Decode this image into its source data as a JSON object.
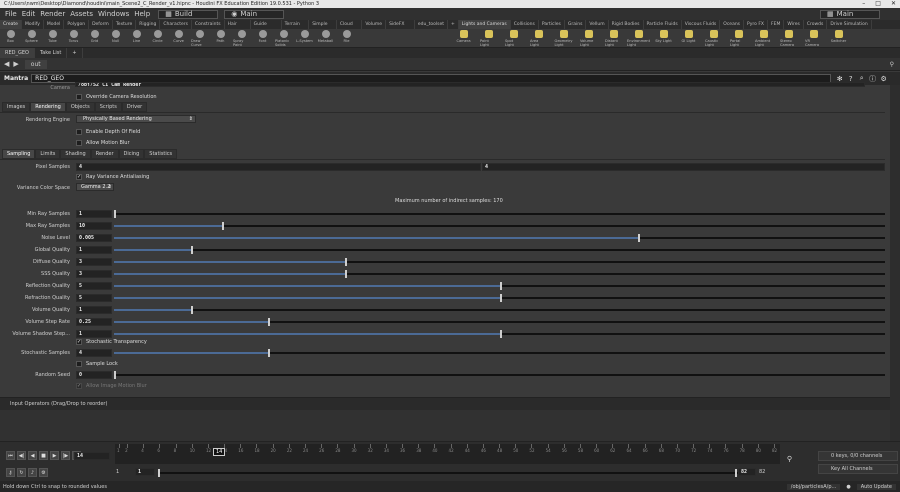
{
  "window": {
    "title": "C:\\Users\\nwm\\Desktop\\Diamond\\houdini\\main_Scene2_C_Render_v1.hipnc - Houdini FX Education Edition 19.0.531 - Python 3"
  },
  "menu": {
    "items": [
      "File",
      "Edit",
      "Render",
      "Assets",
      "Windows",
      "Help"
    ],
    "build_desktop": "Build",
    "main_desktop": "Main",
    "right_desktop": "Main"
  },
  "shelf_tabs_left": [
    "Create",
    "Modify",
    "Model",
    "Polygon",
    "Deform",
    "Texture",
    "Rigging",
    "Characters",
    "Constraints",
    "Hair Utils",
    "Guide Pro...",
    "Terrain FX",
    "Simple FX",
    "Cloud FX",
    "Volume",
    "SideFX L...",
    "edu_toolset"
  ],
  "shelf_tabs_right": [
    "Lights and Cameras",
    "Collisions",
    "Particles",
    "Grains",
    "Vellum",
    "Rigid Bodies",
    "Particle Fluids",
    "Viscous Fluids",
    "Oceans",
    "Pyro FX",
    "FEM",
    "Wires",
    "Crowds",
    "Drive Simulation"
  ],
  "tools_left": [
    "Box",
    "Sphere",
    "Tube",
    "Torus",
    "Grid",
    "Null",
    "Line",
    "Circle",
    "Curve",
    "Draw Curve",
    "Path",
    "Spray Paint",
    "Font",
    "Platonic Solids",
    "L-System",
    "Metaball",
    "File"
  ],
  "tools_right": [
    "Camera",
    "Point Light",
    "Spot Light",
    "Area Light",
    "Geometry Light",
    "Volume Light",
    "Distant Light",
    "Environment Light",
    "Sky Light",
    "GI Light",
    "Caustic Light",
    "Portal Light",
    "Ambient Light",
    "Stereo Camera",
    "VR Camera",
    "Switcher"
  ],
  "pane_tabs": [
    "RED_GEO",
    "Take List",
    "RED_GEO"
  ],
  "path": {
    "node": "out"
  },
  "node": {
    "type": "Mantra",
    "name": "RED_GEO",
    "camera_label": "Camera",
    "camera_value": "/obj/S2_C1_Cam_Render"
  },
  "param_tabs": [
    "Images",
    "Rendering",
    "Objects",
    "Scripts",
    "Driver"
  ],
  "override_cam": "Override Camera Resolution",
  "engine": {
    "label": "Rendering Engine",
    "value": "Physically Based Rendering"
  },
  "dof": "Enable Depth Of Field",
  "mblur": "Allow Motion Blur",
  "sub_tabs": [
    "Sampling",
    "Limits",
    "Shading",
    "Render",
    "Dicing",
    "Statistics"
  ],
  "pixel_samples": {
    "label": "Pixel Samples",
    "v1": "4",
    "v2": "4"
  },
  "ray_aa": "Ray Variance Antialiasing",
  "color_space": {
    "label": "Variance Color Space",
    "value": "Gamma 2.2"
  },
  "indirect_note": "Maximum number of indirect samples: 170",
  "sliders": [
    {
      "label": "Min Ray Samples",
      "value": "1",
      "frac": 0.0
    },
    {
      "label": "Max Ray Samples",
      "value": "10",
      "frac": 0.14
    },
    {
      "label": "Noise Level",
      "value": "0.005",
      "frac": 0.68
    },
    {
      "label": "Global Quality",
      "value": "1",
      "frac": 0.1
    },
    {
      "label": "Diffuse Quality",
      "value": "3",
      "frac": 0.3
    },
    {
      "label": "SSS Quality",
      "value": "3",
      "frac": 0.3
    },
    {
      "label": "Reflection Quality",
      "value": "5",
      "frac": 0.5
    },
    {
      "label": "Refraction Quality",
      "value": "5",
      "frac": 0.5
    },
    {
      "label": "Volume Quality",
      "value": "1",
      "frac": 0.1
    },
    {
      "label": "Volume Step Rate",
      "value": "0.25",
      "frac": 0.2
    },
    {
      "label": "Volume Shadow Step...",
      "value": "1",
      "frac": 0.5
    }
  ],
  "stochastic_transp": "Stochastic Transparency",
  "stochastic_samples": {
    "label": "Stochastic Samples",
    "value": "4",
    "frac": 0.2
  },
  "sample_lock": "Sample Lock",
  "random_seed": {
    "label": "Random Seed",
    "value": "0",
    "frac": 0.0
  },
  "image_mblur": "Allow Image Motion Blur",
  "input_ops": "Input Operators (Drag/Drop to reorder)",
  "timeline": {
    "frame": "14",
    "current_marker": "14",
    "start": "1",
    "range_start": "1",
    "range_end": "82",
    "end": "82",
    "keys": "0 keys, 0/0 channels",
    "channels": "Key All Channels",
    "ticks": [
      "1",
      "2",
      "4",
      "6",
      "8",
      "10",
      "12",
      "14",
      "16",
      "18",
      "20",
      "22",
      "24",
      "26",
      "28",
      "30",
      "32",
      "34",
      "36",
      "38",
      "40",
      "42",
      "44",
      "46",
      "48",
      "50",
      "52",
      "54",
      "56",
      "58",
      "60",
      "62",
      "64",
      "66",
      "68",
      "70",
      "72",
      "74",
      "76",
      "78",
      "80",
      "82"
    ]
  },
  "status": {
    "hint": "Hold down Ctrl to snap to rounded values",
    "path": "/obj/particlesA/p...",
    "update": "Auto Update"
  }
}
